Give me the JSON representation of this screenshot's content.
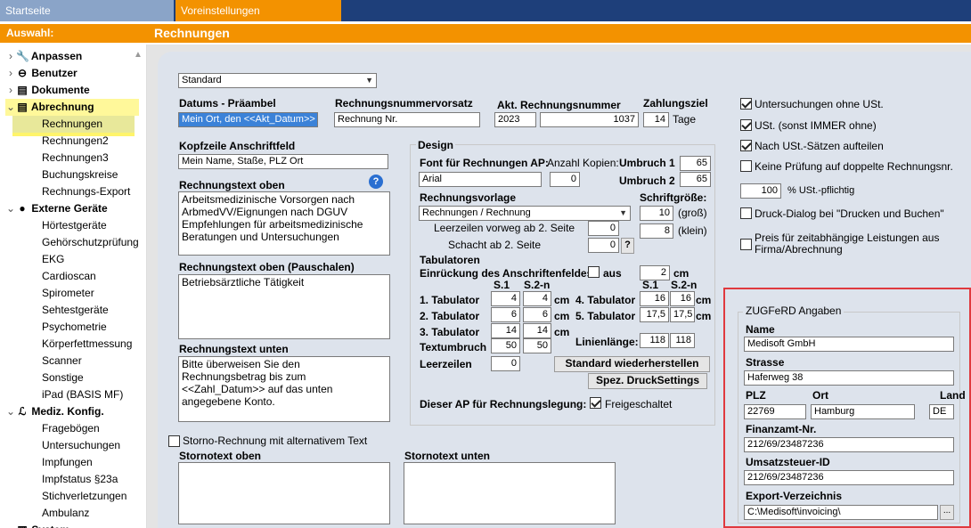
{
  "tabs": {
    "start": "Startseite",
    "preferences": "Voreinstellungen"
  },
  "bar": {
    "left": "Auswahl:",
    "title": "Rechnungen"
  },
  "sidebar": {
    "items": [
      {
        "label": "Anpassen",
        "type": "group",
        "chevron": "›"
      },
      {
        "label": "Benutzer",
        "type": "group",
        "chevron": "›"
      },
      {
        "label": "Dokumente",
        "type": "group",
        "chevron": "›"
      },
      {
        "label": "Abrechnung",
        "type": "group",
        "chevron": "⌄"
      },
      {
        "label": "Rechnungen",
        "type": "item"
      },
      {
        "label": "Rechnungen2",
        "type": "item"
      },
      {
        "label": "Rechnungen3",
        "type": "item"
      },
      {
        "label": "Buchungskreise",
        "type": "item"
      },
      {
        "label": "Rechnungs-Export",
        "type": "item"
      },
      {
        "label": "Externe Geräte",
        "type": "group",
        "chevron": "⌄"
      },
      {
        "label": "Hörtestgeräte",
        "type": "item"
      },
      {
        "label": "Gehörschutzprüfung",
        "type": "item"
      },
      {
        "label": "EKG",
        "type": "item"
      },
      {
        "label": "Cardioscan",
        "type": "item"
      },
      {
        "label": "Spirometer",
        "type": "item"
      },
      {
        "label": "Sehtestgeräte",
        "type": "item"
      },
      {
        "label": "Psychometrie",
        "type": "item"
      },
      {
        "label": "Körperfettmessung",
        "type": "item"
      },
      {
        "label": "Scanner",
        "type": "item"
      },
      {
        "label": "Sonstige",
        "type": "item"
      },
      {
        "label": "iPad (BASIS MF)",
        "type": "item"
      },
      {
        "label": "Mediz. Konfig.",
        "type": "group",
        "chevron": "⌄"
      },
      {
        "label": "Fragebögen",
        "type": "item"
      },
      {
        "label": "Untersuchungen",
        "type": "item"
      },
      {
        "label": "Impfungen",
        "type": "item"
      },
      {
        "label": "Impfstatus §23a",
        "type": "item"
      },
      {
        "label": "Stichverletzungen",
        "type": "item"
      },
      {
        "label": "Ambulanz",
        "type": "item"
      },
      {
        "label": "System",
        "type": "group",
        "chevron": "⌄"
      }
    ]
  },
  "form": {
    "profile": "Standard",
    "datums_label": "Datums - Präambel",
    "datums_value": "Mein Ort, den <<Akt_Datum>>",
    "rnv_label": "Rechnungsnummervorsatz",
    "rnv_value": "Rechnung Nr.",
    "akt_label": "Akt. Rechnungsnummer",
    "akt_year": "2023",
    "akt_num": "1037",
    "zahl_label": "Zahlungsziel",
    "zahl_value": "14",
    "zahl_unit": "Tage",
    "kopf_label": "Kopfzeile Anschriftfeld",
    "kopf_value": "Mein Name, Staße, PLZ Ort",
    "oben_label": "Rechnungstext oben",
    "help": "?",
    "oben_value": "Arbeitsmedizinische Vorsorgen nach ArbmedVV/Eignungen nach DGUV Empfehlungen für arbeitsmedizinische Beratungen und Untersuchungen",
    "pausch_label": "Rechnungstext oben (Pauschalen)",
    "pausch_value": "Betriebsärztliche Tätigkeit",
    "unten_label": "Rechnungstext unten",
    "unten_value": "Bitte überweisen Sie den Rechnungsbetrag bis zum <<Zahl_Datum>> auf das unten angegebene Konto.",
    "storno_cb": "Storno-Rechnung mit alternativem Text",
    "storno_oben": "Stornotext oben",
    "storno_unten": "Stornotext unten"
  },
  "design": {
    "title": "Design",
    "font_label": "Font für Rechnungen AP:",
    "font_value": "Arial",
    "kopien_label": "Anzahl Kopien:",
    "kopien_value": "0",
    "umbruch1_label": "Umbruch 1",
    "umbruch1_value": "65",
    "umbruch2_label": "Umbruch 2",
    "umbruch2_value": "65",
    "vorlage_label": "Rechnungsvorlage",
    "vorlage_value": "Rechnungen / Rechnung",
    "schrift_label": "Schriftgröße:",
    "schrift_gross": "10",
    "gross": "(groß)",
    "schrift_klein": "8",
    "klein": "(klein)",
    "leer_label": "Leerzeilen vorweg ab 2. Seite",
    "leer_value": "0",
    "schacht_label": "Schacht ab 2. Seite",
    "schacht_value": "0",
    "q": "?",
    "tab_label": "Tabulatoren",
    "einr_label": "Einrückung des Anschriftenfeldes",
    "aus": "aus",
    "einr_value": "2",
    "cm": "cm",
    "s1": "S.1",
    "s2": "S.2-n",
    "t1": "1. Tabulator",
    "t1a": "4",
    "t1b": "4",
    "t2": "2. Tabulator",
    "t2a": "6",
    "t2b": "6",
    "t3": "3. Tabulator",
    "t3a": "14",
    "t3b": "14",
    "t4": "4. Tabulator",
    "t4a": "16",
    "t4b": "16",
    "t5": "5. Tabulator",
    "t5a": "17,5",
    "t5b": "17,5",
    "textumbruch": "Textumbruch",
    "tu_a": "50",
    "tu_b": "50",
    "linien_label": "Linienlänge:",
    "linien_a": "118",
    "linien_b": "118",
    "leerzeilen": "Leerzeilen",
    "leerzeilen_value": "0",
    "std_btn": "Standard wiederherstellen",
    "spez_btn": "Spez. DruckSettings",
    "ap_label": "Dieser AP für Rechnungslegung:",
    "freigeschaltet": "Freigeschaltet"
  },
  "options": {
    "o1": "Untersuchungen ohne USt.",
    "o2": "USt. (sonst IMMER ohne)",
    "o3": "Nach USt.-Sätzen aufteilen",
    "o4": "Keine Prüfung auf doppelte Rechnungsnr.",
    "ust_value": "100",
    "ust_label": "% USt.-pflichtig",
    "o5": "Druck-Dialog bei \"Drucken und Buchen\"",
    "o6": "Preis für zeitabhängige Leistungen aus Firma/Abrechnung"
  },
  "zugferd": {
    "title": "ZUGFeRD Angaben",
    "name_label": "Name",
    "name": "Medisoft GmbH",
    "strasse_label": "Strasse",
    "strasse": "Haferweg 38",
    "plz_label": "PLZ",
    "plz": "22769",
    "ort_label": "Ort",
    "ort": "Hamburg",
    "land_label": "Land",
    "land": "DE",
    "fa_label": "Finanzamt-Nr.",
    "fa": "212/69/23487236",
    "ust_label": "Umsatzsteuer-ID",
    "ust": "212/69/23487236",
    "exp_label": "Export-Verzeichnis",
    "exp": "C:\\Medisoft\\invoicing\\",
    "browse": "..."
  }
}
